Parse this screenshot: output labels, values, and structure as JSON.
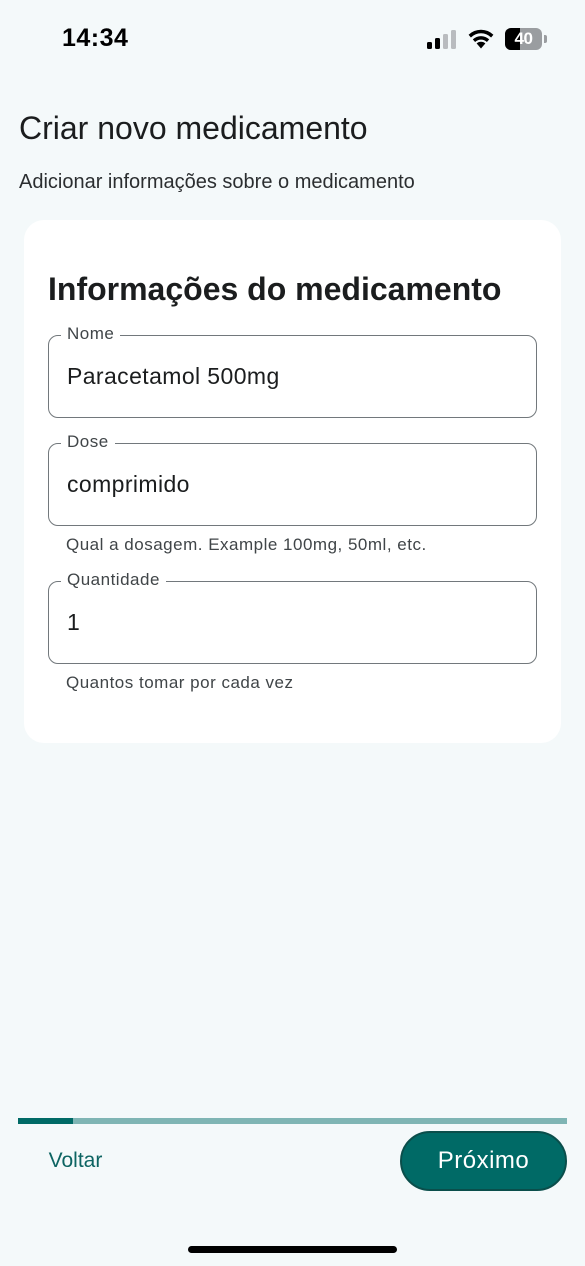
{
  "status_bar": {
    "time": "14:34",
    "battery_level": "40",
    "battery_fraction": 0.4,
    "signal_bars_active": 2,
    "signal_bars_total": 4
  },
  "header": {
    "title": "Criar novo medicamento",
    "subtitle": "Adicionar informações sobre o medicamento"
  },
  "card": {
    "title": "Informações do medicamento",
    "fields": {
      "name": {
        "label": "Nome",
        "value": "Paracetamol 500mg"
      },
      "dose": {
        "label": "Dose",
        "value": "comprimido",
        "helper": "Qual a dosagem. Example 100mg, 50ml, etc."
      },
      "quantity": {
        "label": "Quantidade",
        "value": "1",
        "helper": "Quantos tomar por cada vez"
      }
    }
  },
  "progress": {
    "fraction": 0.1
  },
  "navigation": {
    "back_label": "Voltar",
    "next_label": "Próximo"
  },
  "colors": {
    "primary": "#006a66",
    "progress_track": "#7fb5b4",
    "background": "#f4f9fa"
  },
  "icons": [
    "signal-icon",
    "wifi-icon",
    "battery-icon"
  ]
}
